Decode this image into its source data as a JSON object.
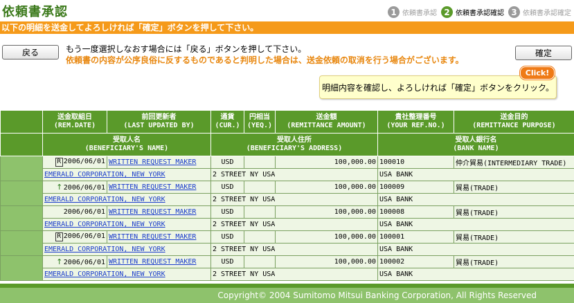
{
  "page": {
    "title": "依頼書承認"
  },
  "steps": [
    {
      "num": "1",
      "label": "依頼書承認"
    },
    {
      "num": "2",
      "label": "依頼書承認確認"
    },
    {
      "num": "3",
      "label": "依頼書承認確定"
    }
  ],
  "banner": "以下の明細を送金してよろしければ「確定」ボタンを押して下さい。",
  "buttons": {
    "back": "戻る",
    "confirm": "確定"
  },
  "messages": {
    "line1": "もう一度選択しなおす場合には「戻る」ボタンを押して下さい。",
    "line2": "依頼書の内容が公序良俗に反するものであると判明した場合は、送金依頼の取消を行う場合がございます。"
  },
  "click_badge": "Click!",
  "tooltip": "明細内容を確認し、よろしければ「確定」ボタンをクリック。",
  "table": {
    "headers_row1": [
      {
        "jp": "送金取組日",
        "en": "(REM.DATE)"
      },
      {
        "jp": "前回更新者",
        "en": "(LAST UPDATED BY)"
      },
      {
        "jp": "通貨",
        "en": "(CUR.)"
      },
      {
        "jp": "円相当",
        "en": "(YEQ.)"
      },
      {
        "jp": "送金額",
        "en": "(REMITTANCE AMOUNT)"
      },
      {
        "jp": "貴社整理番号",
        "en": "(YOUR REF.NO.)"
      },
      {
        "jp": "送金目的",
        "en": "(REMITTANCE PURPOSE)"
      }
    ],
    "headers_row2": [
      {
        "jp": "受取人名",
        "en": "(BENEFICIARY'S NAME)"
      },
      {
        "jp": "受取人住所",
        "en": "(BENEFICIARY'S ADDRESS)"
      },
      {
        "jp": "受取人銀行名",
        "en": "(BANK NAME)"
      }
    ],
    "rows": [
      {
        "icon": "R",
        "date": "2006/06/01",
        "updated_by": "WRITTEN REQUEST MAKER",
        "currency": "USD",
        "yeq": "",
        "amount": "100,000.00",
        "ref": "100010",
        "purpose": "仲介貿易(INTERMEDIARY TRADE)",
        "beneficiary": "EMERALD CORPORATION, NEW YORK",
        "address": "2 STREET NY USA",
        "bank": "USA BANK"
      },
      {
        "icon": "↑",
        "date": "2006/06/01",
        "updated_by": "WRITTEN REQUEST MAKER",
        "currency": "USD",
        "yeq": "",
        "amount": "100,000.00",
        "ref": "100009",
        "purpose": "貿易(TRADE)",
        "beneficiary": "EMERALD CORPORATION, NEW YORK",
        "address": "2 STREET NY USA",
        "bank": "USA BANK"
      },
      {
        "icon": "",
        "date": "2006/06/01",
        "updated_by": "WRITTEN REQUEST MAKER",
        "currency": "USD",
        "yeq": "",
        "amount": "100,000.00",
        "ref": "100008",
        "purpose": "貿易(TRADE)",
        "beneficiary": "EMERALD CORPORATION, NEW YORK",
        "address": "2 STREET NY USA",
        "bank": "USA BANK"
      },
      {
        "icon": "R",
        "date": "2006/06/01",
        "updated_by": "WRITTEN REQUEST MAKER",
        "currency": "USD",
        "yeq": "",
        "amount": "100,000.00",
        "ref": "100001",
        "purpose": "貿易(TRADE)",
        "beneficiary": "EMERALD CORPORATION, NEW YORK",
        "address": "2 STREET NY USA",
        "bank": "USA BANK"
      },
      {
        "icon": "↑",
        "date": "2006/06/01",
        "updated_by": "WRITTEN REQUEST MAKER",
        "currency": "USD",
        "yeq": "",
        "amount": "100,000.00",
        "ref": "100002",
        "purpose": "貿易(TRADE)",
        "beneficiary": "EMERALD CORPORATION, NEW YORK",
        "address": "2 STREET NY USA",
        "bank": "USA BANK"
      }
    ]
  },
  "footer": "Copyright© 2004 Sumitomo Mitsui Banking Corporation, All Rights Reserved"
}
